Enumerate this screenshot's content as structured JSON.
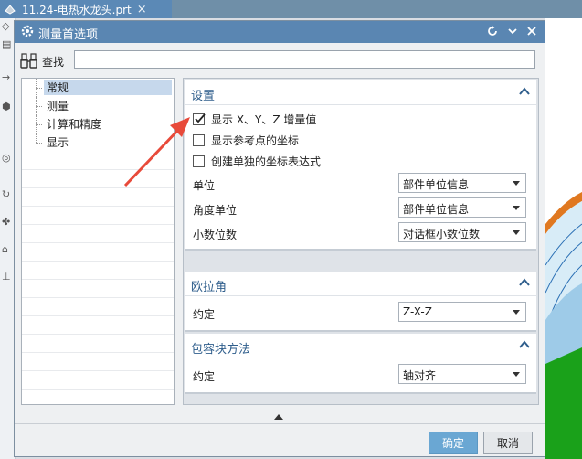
{
  "file_tab": {
    "name": "11.24-电热水龙头.prt",
    "close": "×"
  },
  "dialog": {
    "title": "测量首选项",
    "search": {
      "label": "查找",
      "value": ""
    },
    "tree": [
      "常规",
      "测量",
      "计算和精度",
      "显示"
    ],
    "groups": {
      "settings": {
        "title": "设置",
        "checkboxes": [
          {
            "label": "显示 X、Y、Z 增量值",
            "checked": true
          },
          {
            "label": "显示参考点的坐标",
            "checked": false
          },
          {
            "label": "创建单独的坐标表达式",
            "checked": false
          }
        ],
        "rows": [
          {
            "label": "单位",
            "value": "部件单位信息"
          },
          {
            "label": "角度单位",
            "value": "部件单位信息"
          },
          {
            "label": "小数位数",
            "value": "对话框小数位数"
          }
        ]
      },
      "euler": {
        "title": "欧拉角",
        "row": {
          "label": "约定",
          "value": "Z-X-Z"
        }
      },
      "bbox": {
        "title": "包容块方法",
        "row": {
          "label": "约定",
          "value": "轴对齐"
        }
      }
    },
    "buttons": {
      "ok": "确定",
      "cancel": "取消"
    }
  },
  "colors": {
    "accent": "#5a86b2",
    "ok_button": "#6aa7d3",
    "annotation_arrow": "#e84a3a",
    "group_title": "#2f5e8c"
  }
}
